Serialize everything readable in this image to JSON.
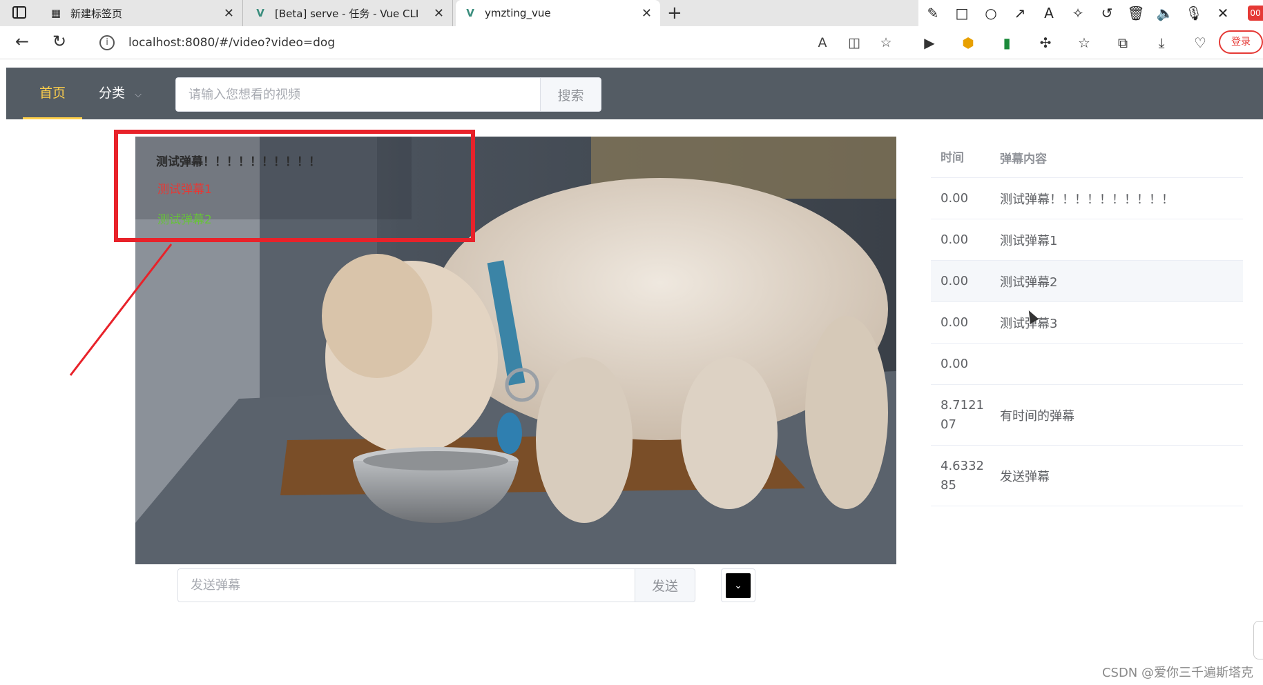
{
  "browser": {
    "tabs": [
      {
        "title": "新建标签页"
      },
      {
        "title": "[Beta] serve - 任务 - Vue CLI"
      },
      {
        "title": "ymzting_vue"
      }
    ],
    "url": "localhost:8080/#/video?video=dog",
    "login_label": "登录",
    "badge": "00"
  },
  "nav": {
    "home": "首页",
    "category": "分类",
    "search_placeholder": "请输入您想看的视频",
    "search_button": "搜索"
  },
  "video": {
    "danmu": [
      {
        "text": "测试弹幕！！！！！！！！！！",
        "color": "#2b2b2b"
      },
      {
        "text": "测试弹幕1",
        "color": "#e53935"
      },
      {
        "text": "测试弹幕2",
        "color": "#67c23a"
      }
    ]
  },
  "send": {
    "placeholder": "发送弹幕",
    "button": "发送",
    "color": "#000000"
  },
  "table": {
    "headers": {
      "time": "时间",
      "content": "弹幕内容"
    },
    "rows": [
      {
        "time": "0.00",
        "content": "测试弹幕！！！！！！！！！！"
      },
      {
        "time": "0.00",
        "content": "测试弹幕1"
      },
      {
        "time": "0.00",
        "content": "测试弹幕2"
      },
      {
        "time": "0.00",
        "content": "测试弹幕3"
      },
      {
        "time": "0.00",
        "content": ""
      },
      {
        "time": "8.712107",
        "content": "有时间的弹幕"
      },
      {
        "time": "4.633285",
        "content": "发送弹幕"
      }
    ]
  },
  "footer": {
    "watermark": "CSDN @爱你三千遍斯塔克"
  }
}
